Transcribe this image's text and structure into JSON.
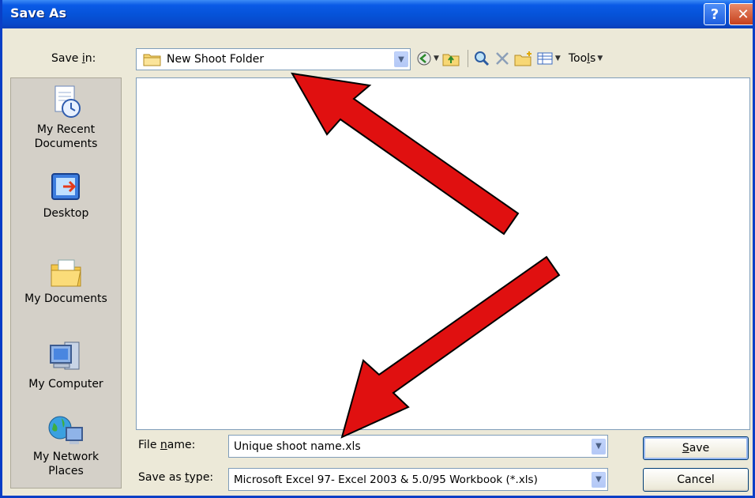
{
  "window": {
    "title": "Save As"
  },
  "titlebar": {
    "help_label": "?",
    "close_label": "✕"
  },
  "save_in": {
    "label_pre": "Save ",
    "label_ul": "i",
    "label_post": "n:",
    "value": "New Shoot Folder"
  },
  "toolbar": {
    "tools_pre": "Too",
    "tools_ul": "l",
    "tools_post": "s"
  },
  "places": [
    {
      "label": "My Recent\nDocuments",
      "icon": "recent-documents-icon"
    },
    {
      "label": "Desktop",
      "icon": "desktop-icon"
    },
    {
      "label": "My Documents",
      "icon": "my-documents-icon"
    },
    {
      "label": "My Computer",
      "icon": "my-computer-icon"
    },
    {
      "label": "My Network\nPlaces",
      "icon": "network-places-icon"
    }
  ],
  "file_name": {
    "label_pre": "File ",
    "label_ul": "n",
    "label_post": "ame:",
    "value": "Unique shoot name.xls"
  },
  "save_type": {
    "label_pre": "Save as ",
    "label_ul": "t",
    "label_post": "ype:",
    "value": "Microsoft Excel 97- Excel 2003 & 5.0/95 Workbook (*.xls)"
  },
  "buttons": {
    "save_ul": "S",
    "save_post": "ave",
    "cancel": "Cancel"
  },
  "colors": {
    "titlebar": "#0653d9",
    "dialog_bg": "#ece9d8",
    "annotation_arrow": "#e01010"
  }
}
